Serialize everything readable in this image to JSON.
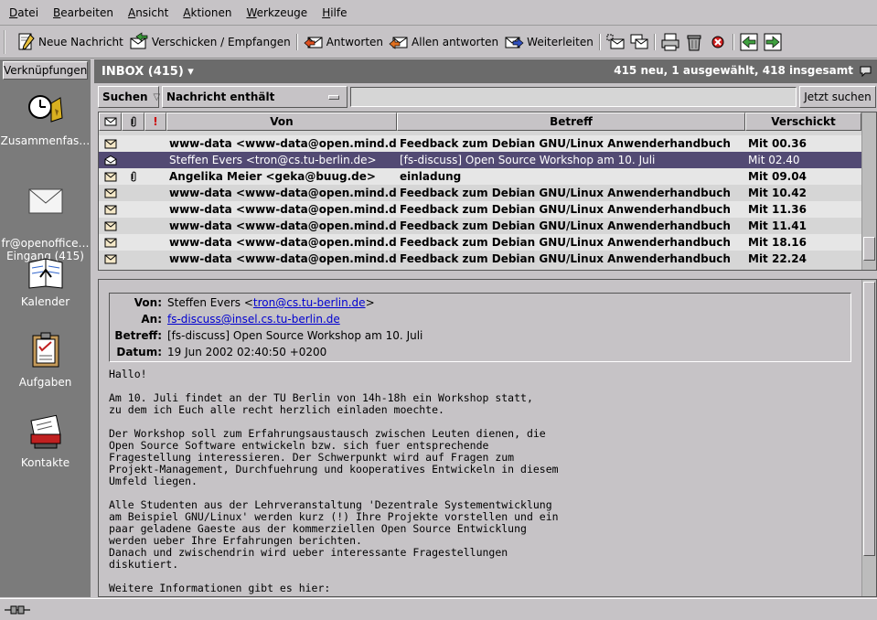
{
  "menu": [
    "Datei",
    "Bearbeiten",
    "Ansicht",
    "Aktionen",
    "Werkzeuge",
    "Hilfe"
  ],
  "toolbar": {
    "new": "Neue Nachricht",
    "sendrecv": "Verschicken / Empfangen",
    "reply": "Antworten",
    "replyall": "Allen antworten",
    "forward": "Weiterleiten"
  },
  "shortcuts": {
    "header": "Verknüpfungen",
    "items": [
      "Zusammenfas…",
      "fr@openoffice…\nEingang (415)",
      "Kalender",
      "Aufgaben",
      "Kontakte"
    ]
  },
  "folder": {
    "name": "INBOX (415) ▾",
    "status": "415 neu, 1 ausgewählt, 418 insgesamt"
  },
  "search": {
    "button": "Suchen",
    "criteria": "Nachricht enthält",
    "value": "",
    "go": "Jetzt suchen"
  },
  "columns": {
    "from": "Von",
    "subject": "Betreff",
    "sent": "Verschickt"
  },
  "messages": [
    {
      "from": "www-data <www-data@open.mind.de>",
      "subject": "Feedback zum Debian GNU/Linux Anwenderhandbuch",
      "date": "Mit 00.36"
    },
    {
      "from": "Steffen Evers <tron@cs.tu-berlin.de>",
      "subject": "[fs-discuss] Open Source Workshop am 10. Juli",
      "date": "Mit 02.40"
    },
    {
      "from": "Angelika Meier <geka@buug.de>",
      "subject": "einladung",
      "date": "Mit 09.04"
    },
    {
      "from": "www-data <www-data@open.mind.de>",
      "subject": "Feedback zum Debian GNU/Linux Anwenderhandbuch",
      "date": "Mit 10.42"
    },
    {
      "from": "www-data <www-data@open.mind.de>",
      "subject": "Feedback zum Debian GNU/Linux Anwenderhandbuch",
      "date": "Mit 11.36"
    },
    {
      "from": "www-data <www-data@open.mind.de>",
      "subject": "Feedback zum Debian GNU/Linux Anwenderhandbuch",
      "date": "Mit 11.41"
    },
    {
      "from": "www-data <www-data@open.mind.de>",
      "subject": "Feedback zum Debian GNU/Linux Anwenderhandbuch",
      "date": "Mit 18.16"
    },
    {
      "from": "www-data <www-data@open.mind.de>",
      "subject": "Feedback zum Debian GNU/Linux Anwenderhandbuch",
      "date": "Mit 22.24"
    }
  ],
  "preview": {
    "labels": {
      "from": "Von:",
      "to": "An:",
      "subject": "Betreff:",
      "date": "Datum:"
    },
    "from_name": "Steffen Evers <",
    "from_email": "tron@cs.tu-berlin.de",
    "from_close": ">",
    "to": "fs-discuss@insel.cs.tu-berlin.de",
    "subject": "[fs-discuss] Open Source Workshop am 10. Juli",
    "date": "19 Jun 2002 02:40:50 +0200",
    "body": "Hallo!\n\nAm 10. Juli findet an der TU Berlin von 14h-18h ein Workshop statt,\nzu dem ich Euch alle recht herzlich einladen moechte.\n\nDer Workshop soll zum Erfahrungsaustausch zwischen Leuten dienen, die\nOpen Source Software entwickeln bzw. sich fuer entsprechende\nFragestellung interessieren. Der Schwerpunkt wird auf Fragen zum\nProjekt-Management, Durchfuehrung und kooperatives Entwickeln in diesem\nUmfeld liegen.\n\nAlle Studenten aus der Lehrveranstaltung 'Dezentrale Systementwicklung\nam Beispiel GNU/Linux' werden kurz (!) Ihre Projekte vorstellen und ein\npaar geladene Gaeste aus der kommerziellen Open Source Entwicklung\nwerden ueber Ihre Erfahrungen berichten.\nDanach und zwischendrin wird ueber interessante Fragestellungen\ndiskutiert.\n\nWeitere Informationen gibt es hier:"
  }
}
